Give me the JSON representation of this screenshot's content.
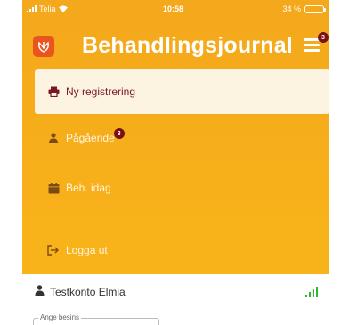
{
  "status": {
    "carrier": "Telia",
    "time": "10:58",
    "battery": "34 %",
    "battery_level": 0.34
  },
  "header": {
    "title": "Behandlingsjournal",
    "menu_badge": "3"
  },
  "menu": {
    "items": [
      {
        "label": "Ny registrering",
        "icon": "printer-icon",
        "active": true
      },
      {
        "label": "Pågående",
        "icon": "person-icon",
        "badge": "3"
      },
      {
        "label": "Beh. idag",
        "icon": "calendar-icon"
      },
      {
        "label": "Logga ut",
        "icon": "logout-icon"
      }
    ]
  },
  "account": {
    "name": "Testkonto Elmia",
    "signal_icon": "signal-bars-icon"
  },
  "field": {
    "legend": "Ange besins"
  },
  "colors": {
    "accent": "#f6ad1a",
    "active_text": "#7a1626",
    "badge": "#7a0f14",
    "signal": "#2eb82e"
  }
}
